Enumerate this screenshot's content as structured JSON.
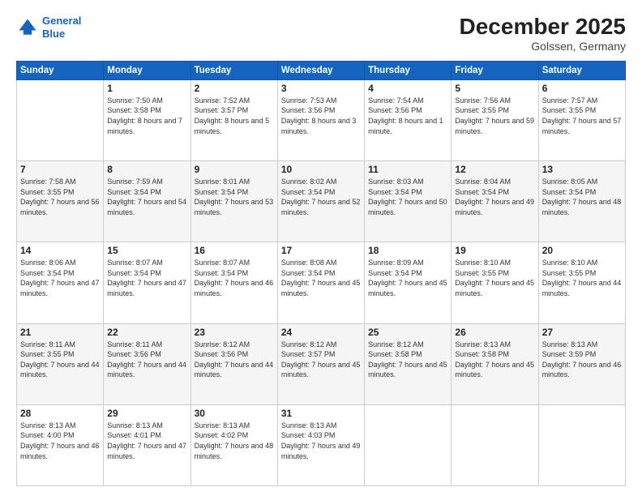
{
  "logo": {
    "line1": "General",
    "line2": "Blue"
  },
  "header": {
    "month": "December 2025",
    "location": "Golssen, Germany"
  },
  "days_of_week": [
    "Sunday",
    "Monday",
    "Tuesday",
    "Wednesday",
    "Thursday",
    "Friday",
    "Saturday"
  ],
  "weeks": [
    [
      {
        "num": "",
        "sunrise": "",
        "sunset": "",
        "daylight": ""
      },
      {
        "num": "1",
        "sunrise": "Sunrise: 7:50 AM",
        "sunset": "Sunset: 3:58 PM",
        "daylight": "Daylight: 8 hours and 7 minutes."
      },
      {
        "num": "2",
        "sunrise": "Sunrise: 7:52 AM",
        "sunset": "Sunset: 3:57 PM",
        "daylight": "Daylight: 8 hours and 5 minutes."
      },
      {
        "num": "3",
        "sunrise": "Sunrise: 7:53 AM",
        "sunset": "Sunset: 3:56 PM",
        "daylight": "Daylight: 8 hours and 3 minutes."
      },
      {
        "num": "4",
        "sunrise": "Sunrise: 7:54 AM",
        "sunset": "Sunset: 3:56 PM",
        "daylight": "Daylight: 8 hours and 1 minute."
      },
      {
        "num": "5",
        "sunrise": "Sunrise: 7:56 AM",
        "sunset": "Sunset: 3:55 PM",
        "daylight": "Daylight: 7 hours and 59 minutes."
      },
      {
        "num": "6",
        "sunrise": "Sunrise: 7:57 AM",
        "sunset": "Sunset: 3:55 PM",
        "daylight": "Daylight: 7 hours and 57 minutes."
      }
    ],
    [
      {
        "num": "7",
        "sunrise": "Sunrise: 7:58 AM",
        "sunset": "Sunset: 3:55 PM",
        "daylight": "Daylight: 7 hours and 56 minutes."
      },
      {
        "num": "8",
        "sunrise": "Sunrise: 7:59 AM",
        "sunset": "Sunset: 3:54 PM",
        "daylight": "Daylight: 7 hours and 54 minutes."
      },
      {
        "num": "9",
        "sunrise": "Sunrise: 8:01 AM",
        "sunset": "Sunset: 3:54 PM",
        "daylight": "Daylight: 7 hours and 53 minutes."
      },
      {
        "num": "10",
        "sunrise": "Sunrise: 8:02 AM",
        "sunset": "Sunset: 3:54 PM",
        "daylight": "Daylight: 7 hours and 52 minutes."
      },
      {
        "num": "11",
        "sunrise": "Sunrise: 8:03 AM",
        "sunset": "Sunset: 3:54 PM",
        "daylight": "Daylight: 7 hours and 50 minutes."
      },
      {
        "num": "12",
        "sunrise": "Sunrise: 8:04 AM",
        "sunset": "Sunset: 3:54 PM",
        "daylight": "Daylight: 7 hours and 49 minutes."
      },
      {
        "num": "13",
        "sunrise": "Sunrise: 8:05 AM",
        "sunset": "Sunset: 3:54 PM",
        "daylight": "Daylight: 7 hours and 48 minutes."
      }
    ],
    [
      {
        "num": "14",
        "sunrise": "Sunrise: 8:06 AM",
        "sunset": "Sunset: 3:54 PM",
        "daylight": "Daylight: 7 hours and 47 minutes."
      },
      {
        "num": "15",
        "sunrise": "Sunrise: 8:07 AM",
        "sunset": "Sunset: 3:54 PM",
        "daylight": "Daylight: 7 hours and 47 minutes."
      },
      {
        "num": "16",
        "sunrise": "Sunrise: 8:07 AM",
        "sunset": "Sunset: 3:54 PM",
        "daylight": "Daylight: 7 hours and 46 minutes."
      },
      {
        "num": "17",
        "sunrise": "Sunrise: 8:08 AM",
        "sunset": "Sunset: 3:54 PM",
        "daylight": "Daylight: 7 hours and 45 minutes."
      },
      {
        "num": "18",
        "sunrise": "Sunrise: 8:09 AM",
        "sunset": "Sunset: 3:54 PM",
        "daylight": "Daylight: 7 hours and 45 minutes."
      },
      {
        "num": "19",
        "sunrise": "Sunrise: 8:10 AM",
        "sunset": "Sunset: 3:55 PM",
        "daylight": "Daylight: 7 hours and 45 minutes."
      },
      {
        "num": "20",
        "sunrise": "Sunrise: 8:10 AM",
        "sunset": "Sunset: 3:55 PM",
        "daylight": "Daylight: 7 hours and 44 minutes."
      }
    ],
    [
      {
        "num": "21",
        "sunrise": "Sunrise: 8:11 AM",
        "sunset": "Sunset: 3:55 PM",
        "daylight": "Daylight: 7 hours and 44 minutes."
      },
      {
        "num": "22",
        "sunrise": "Sunrise: 8:11 AM",
        "sunset": "Sunset: 3:56 PM",
        "daylight": "Daylight: 7 hours and 44 minutes."
      },
      {
        "num": "23",
        "sunrise": "Sunrise: 8:12 AM",
        "sunset": "Sunset: 3:56 PM",
        "daylight": "Daylight: 7 hours and 44 minutes."
      },
      {
        "num": "24",
        "sunrise": "Sunrise: 8:12 AM",
        "sunset": "Sunset: 3:57 PM",
        "daylight": "Daylight: 7 hours and 45 minutes."
      },
      {
        "num": "25",
        "sunrise": "Sunrise: 8:12 AM",
        "sunset": "Sunset: 3:58 PM",
        "daylight": "Daylight: 7 hours and 45 minutes."
      },
      {
        "num": "26",
        "sunrise": "Sunrise: 8:13 AM",
        "sunset": "Sunset: 3:58 PM",
        "daylight": "Daylight: 7 hours and 45 minutes."
      },
      {
        "num": "27",
        "sunrise": "Sunrise: 8:13 AM",
        "sunset": "Sunset: 3:59 PM",
        "daylight": "Daylight: 7 hours and 46 minutes."
      }
    ],
    [
      {
        "num": "28",
        "sunrise": "Sunrise: 8:13 AM",
        "sunset": "Sunset: 4:00 PM",
        "daylight": "Daylight: 7 hours and 46 minutes."
      },
      {
        "num": "29",
        "sunrise": "Sunrise: 8:13 AM",
        "sunset": "Sunset: 4:01 PM",
        "daylight": "Daylight: 7 hours and 47 minutes."
      },
      {
        "num": "30",
        "sunrise": "Sunrise: 8:13 AM",
        "sunset": "Sunset: 4:02 PM",
        "daylight": "Daylight: 7 hours and 48 minutes."
      },
      {
        "num": "31",
        "sunrise": "Sunrise: 8:13 AM",
        "sunset": "Sunset: 4:03 PM",
        "daylight": "Daylight: 7 hours and 49 minutes."
      },
      {
        "num": "",
        "sunrise": "",
        "sunset": "",
        "daylight": ""
      },
      {
        "num": "",
        "sunrise": "",
        "sunset": "",
        "daylight": ""
      },
      {
        "num": "",
        "sunrise": "",
        "sunset": "",
        "daylight": ""
      }
    ]
  ]
}
